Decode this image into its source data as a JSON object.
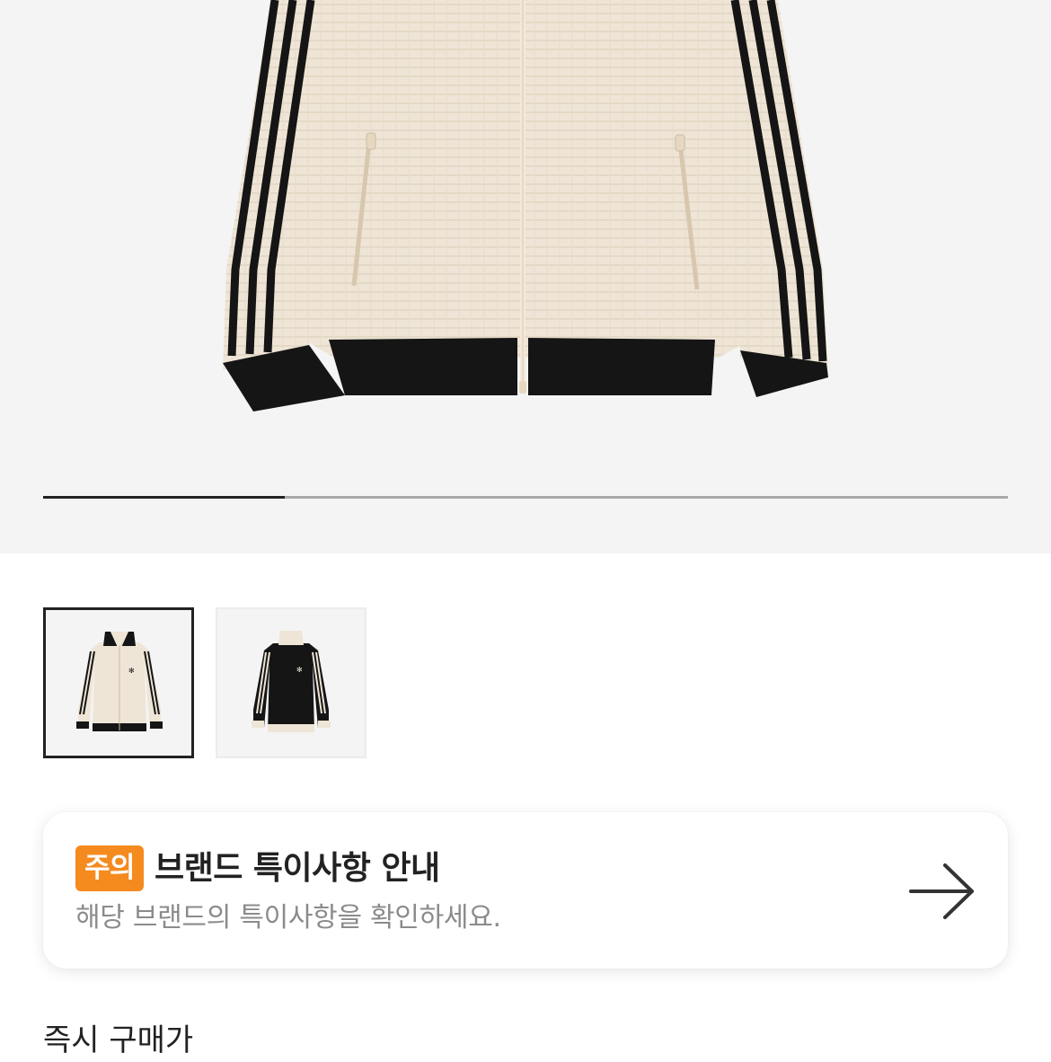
{
  "gallery": {
    "hero_image": "cream waffle-knit track jacket with black three stripes",
    "page_progress": 0.25,
    "thumbnails": [
      {
        "name": "cream-jacket-thumbnail",
        "selected": true
      },
      {
        "name": "black-jacket-thumbnail",
        "selected": false
      }
    ]
  },
  "brand_notice": {
    "badge": "주의",
    "title": "브랜드 특이사항 안내",
    "subtitle": "해당 브랜드의 특이사항을 확인하세요.",
    "icon": "arrow-right-icon"
  },
  "price_section": {
    "title": "즉시 구매가"
  },
  "colors": {
    "badge": "#f58a1f",
    "progress_active": "#222222",
    "progress_track": "#a8a8a8"
  }
}
